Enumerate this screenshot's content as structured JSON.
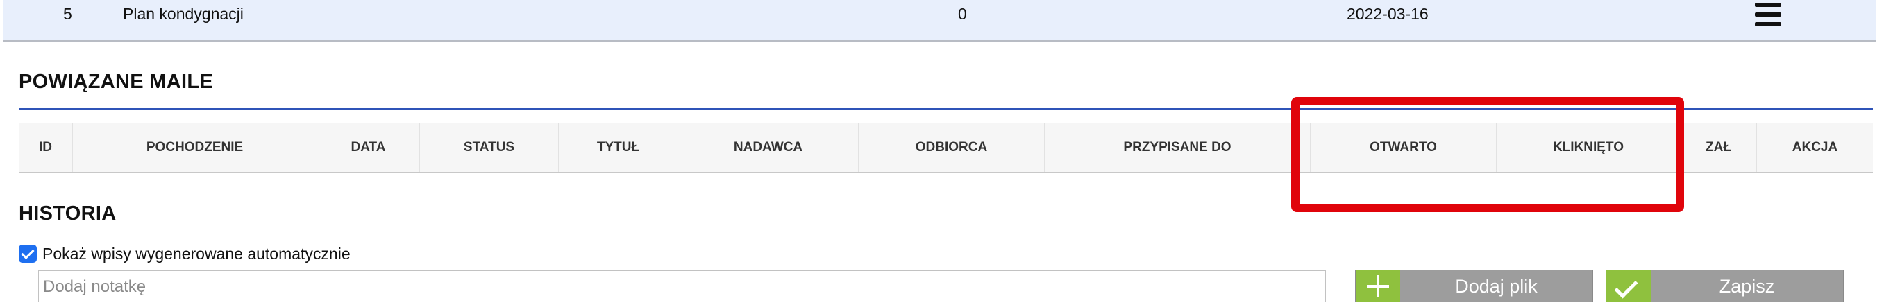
{
  "document_row": {
    "number": "5",
    "name": "Plan kondygnacji",
    "count": "0",
    "date": "2022-03-16",
    "menu_icon": "hamburger-menu-icon"
  },
  "related_mails": {
    "title": "POWIĄZANE MAILE",
    "columns": [
      "ID",
      "POCHODZENIE",
      "DATA",
      "STATUS",
      "TYTUŁ",
      "NADAWCA",
      "ODBIORCA",
      "PRZYPISANE DO",
      "OTWARTO",
      "KLIKNIĘTO",
      "ZAŁ",
      "AKCJA"
    ],
    "highlight_color": "#e0040b"
  },
  "history": {
    "title": "HISTORIA",
    "auto_entries_label": "Pokaż wpisy wygenerowane automatycznie",
    "auto_entries_checked": true,
    "note_placeholder": "Dodaj notatkę",
    "add_file_label": "Dodaj plik",
    "save_label": "Zapisz"
  },
  "colors": {
    "accent_blue": "#2f54b8",
    "button_icon_green": "#8fc13e",
    "button_gray": "#9d9d9d",
    "checkbox_blue": "#1e6ff0"
  }
}
